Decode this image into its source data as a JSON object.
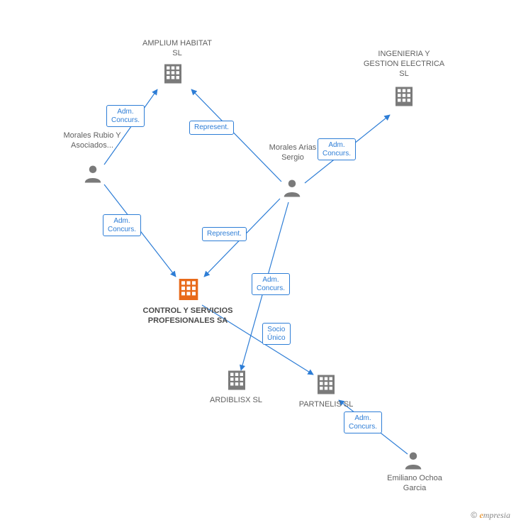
{
  "nodes": {
    "amplium": {
      "label": "AMPLIUM\nHABITAT SL"
    },
    "ingenieria": {
      "label": "INGENIERIA Y\nGESTION\nELECTRICA SL"
    },
    "morales_rubio": {
      "label": "Morales\nRubio Y\nAsociados..."
    },
    "morales_arias": {
      "label": "Morales\nArias\nSergio"
    },
    "control": {
      "label": "CONTROL Y\nSERVICIOS\nPROFESIONALES SA"
    },
    "ardiblisx": {
      "label": "ARDIBLISX SL"
    },
    "partnelis": {
      "label": "PARTNELIS SL"
    },
    "emiliano": {
      "label": "Emiliano\nOchoa\nGarcia"
    }
  },
  "edges": {
    "e1": {
      "label": "Adm.\nConcurs."
    },
    "e2": {
      "label": "Represent."
    },
    "e3": {
      "label": "Adm.\nConcurs."
    },
    "e4": {
      "label": "Adm.\nConcurs."
    },
    "e5": {
      "label": "Represent."
    },
    "e6": {
      "label": "Adm.\nConcurs."
    },
    "e7": {
      "label": "Socio\nÚnico"
    },
    "e8": {
      "label": "Adm.\nConcurs."
    }
  },
  "footer": {
    "copyright": "©",
    "brand_e": "e",
    "brand_rest": "mpresia"
  }
}
